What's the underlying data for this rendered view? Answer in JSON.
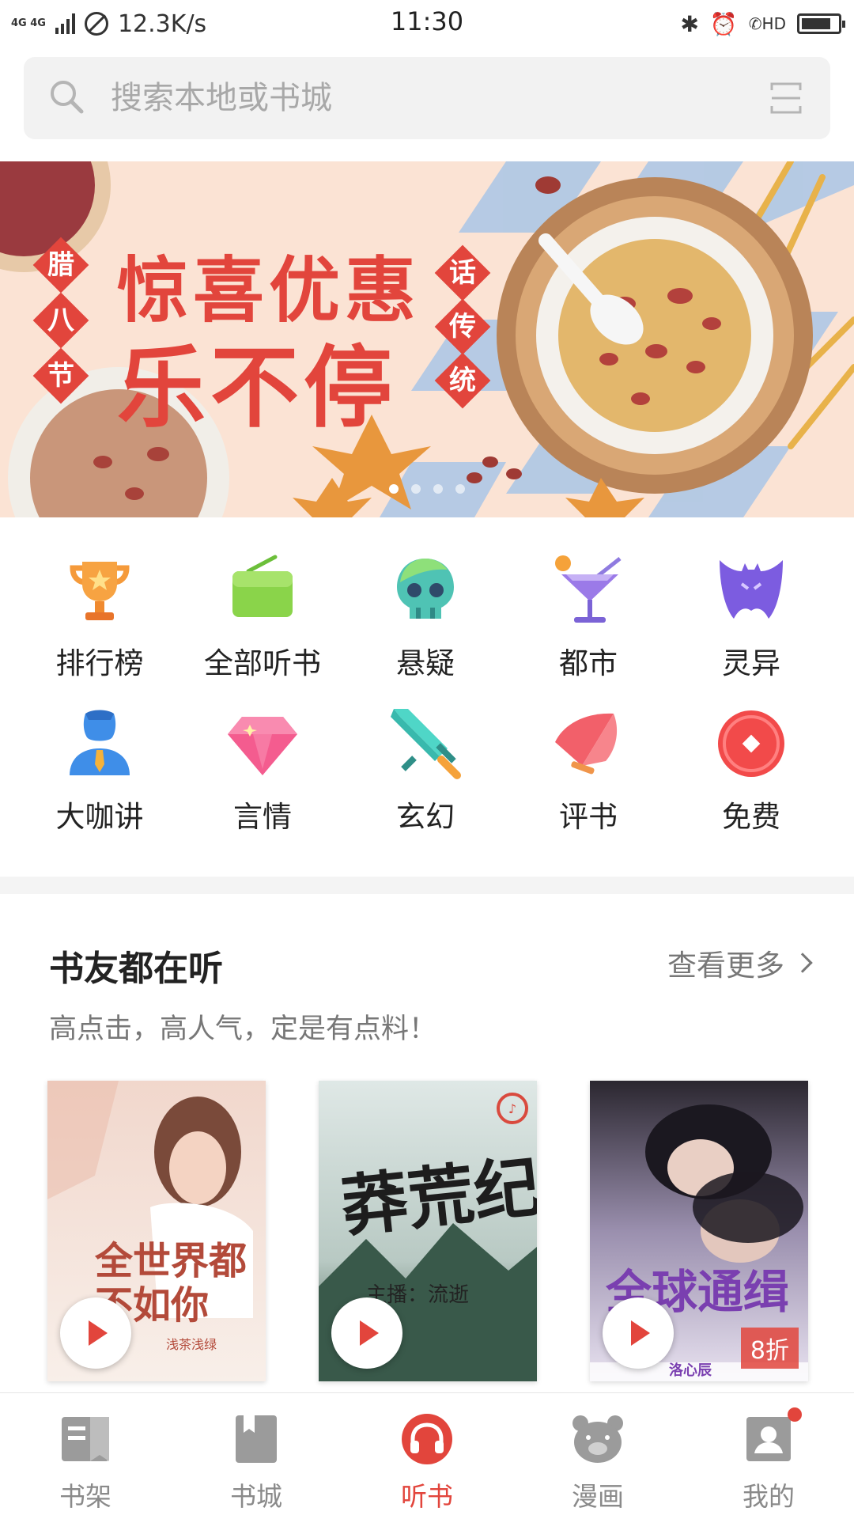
{
  "status_bar": {
    "network": "4G 4G",
    "speed": "12.3K/s",
    "time": "11:30",
    "hd": "HD"
  },
  "search": {
    "placeholder": "搜索本地或书城"
  },
  "banner": {
    "title_line1": "惊喜优惠",
    "title_line2": "乐不停",
    "left_vertical": [
      "腊",
      "八",
      "节"
    ],
    "right_vertical": [
      "话",
      "传",
      "统"
    ],
    "slide_count": 4,
    "active_slide": 1
  },
  "categories": [
    {
      "label": "排行榜",
      "icon": "trophy-icon"
    },
    {
      "label": "全部听书",
      "icon": "radio-icon"
    },
    {
      "label": "悬疑",
      "icon": "skull-icon"
    },
    {
      "label": "都市",
      "icon": "cocktail-icon"
    },
    {
      "label": "灵异",
      "icon": "bat-icon"
    },
    {
      "label": "大咖讲",
      "icon": "speaker-person-icon"
    },
    {
      "label": "言情",
      "icon": "diamond-icon"
    },
    {
      "label": "玄幻",
      "icon": "sword-icon"
    },
    {
      "label": "评书",
      "icon": "fan-icon"
    },
    {
      "label": "免费",
      "icon": "coin-icon"
    }
  ],
  "section": {
    "title": "书友都在听",
    "more": "查看更多",
    "subtitle": "高点击，高人气，定是有点料！"
  },
  "books": [
    {
      "cover_title": "全世界都不如你",
      "author": "浅茶浅绿"
    },
    {
      "cover_title": "莽荒纪",
      "narrator": "主播：流逝"
    },
    {
      "cover_title": "全球通缉",
      "author": "洛心辰",
      "discount": "8折"
    }
  ],
  "tabs": [
    {
      "label": "书架",
      "icon": "bookshelf-icon",
      "active": false
    },
    {
      "label": "书城",
      "icon": "bookstore-icon",
      "active": false
    },
    {
      "label": "听书",
      "icon": "headphones-icon",
      "active": true
    },
    {
      "label": "漫画",
      "icon": "bear-icon",
      "active": false
    },
    {
      "label": "我的",
      "icon": "profile-icon",
      "active": false
    }
  ],
  "colors": {
    "accent": "#e2453c",
    "inactive": "#8a8a8a"
  }
}
